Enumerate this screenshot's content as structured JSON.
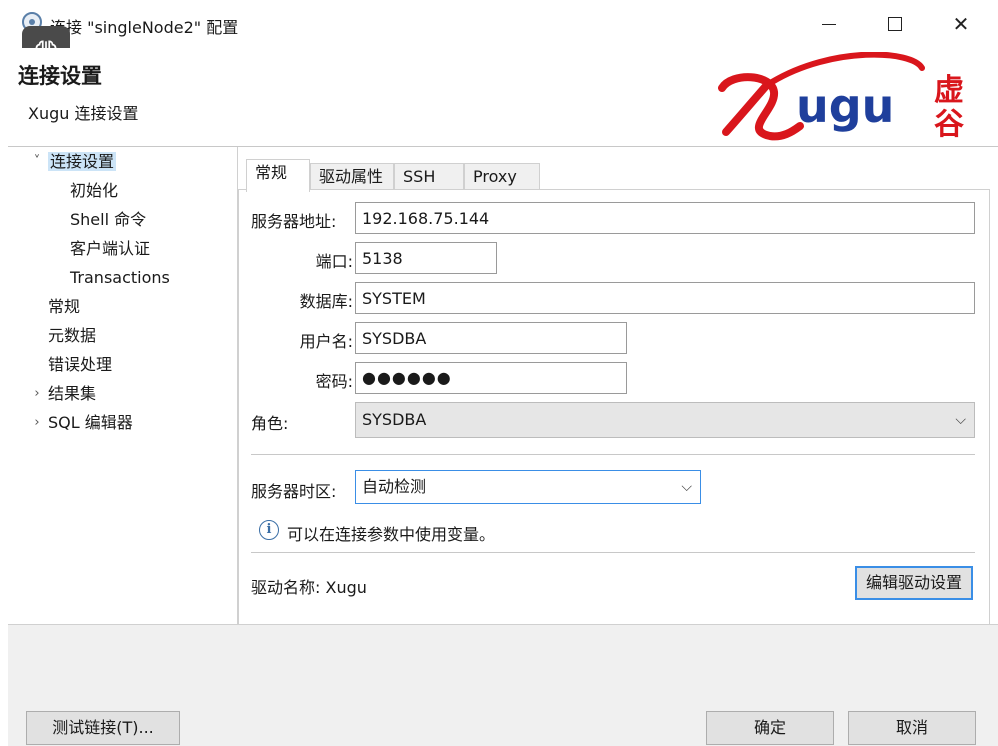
{
  "window": {
    "title": "连接 \"singleNode2\" 配置",
    "minimize_icon": "minimize-icon",
    "maximize_icon": "maximize-icon",
    "close_icon": "close-icon",
    "close_glyph": "✕"
  },
  "header": {
    "title": "连接设置",
    "subtitle": "Xugu 连接设置",
    "logo": {
      "latin": "ugu",
      "cjk_top": "虚",
      "cjk_bottom": "谷",
      "brand_red": "#d9161c",
      "brand_blue": "#1f3f9c"
    }
  },
  "sidebar": {
    "items": [
      {
        "label": "连接设置",
        "expander": "˅",
        "selected": true
      },
      {
        "label": "初始化"
      },
      {
        "label": "Shell 命令"
      },
      {
        "label": "客户端认证"
      },
      {
        "label": "Transactions"
      },
      {
        "label": "常规"
      },
      {
        "label": "元数据"
      },
      {
        "label": "错误处理"
      },
      {
        "label": "结果集",
        "expander": "›"
      },
      {
        "label": "SQL 编辑器",
        "expander": "›"
      }
    ]
  },
  "tabs": [
    {
      "label": "常规",
      "active": true
    },
    {
      "label": "驱动属性"
    },
    {
      "label": "SSH"
    },
    {
      "label": "Proxy"
    }
  ],
  "form": {
    "host": {
      "label": "服务器地址:",
      "value": "192.168.75.144"
    },
    "port": {
      "label": "端口:",
      "value": "5138"
    },
    "database": {
      "label": "数据库:",
      "value": "SYSTEM"
    },
    "username": {
      "label": "用户名:",
      "value": "SYSDBA"
    },
    "password": {
      "label": "密码:",
      "value": "●●●●●●"
    },
    "role": {
      "label": "角色:",
      "value": "SYSDBA"
    },
    "timezone": {
      "label": "服务器时区:",
      "value": "自动检测"
    },
    "dropdown_glyph": "⌵"
  },
  "info": {
    "icon": "info-icon",
    "glyph": "i",
    "text": "可以在连接参数中使用变量。"
  },
  "driver": {
    "label": "驱动名称: Xugu",
    "edit_button": "编辑驱动设置"
  },
  "footer": {
    "test_button": "测试链接(T)...",
    "ok_button": "确定",
    "cancel_button": "取消"
  },
  "colors": {
    "accent": "#3a8ee6",
    "selection": "#cce4f7"
  }
}
